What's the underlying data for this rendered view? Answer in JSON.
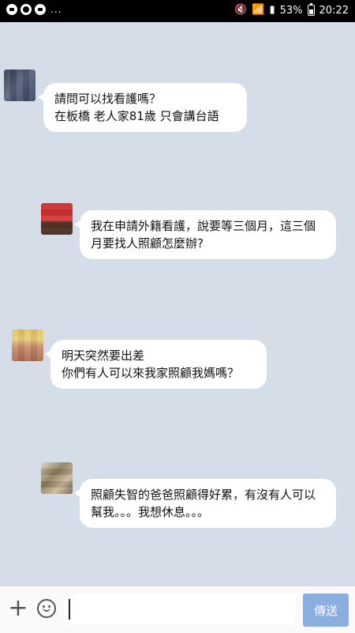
{
  "status_bar": {
    "left_icons": [
      "messenger-icon",
      "smiley-icon",
      "chat-icon"
    ],
    "more": "...",
    "right_icons": [
      "mute-icon",
      "wifi-icon",
      "signal-icon",
      "battery-icon"
    ],
    "battery": "53%",
    "time": "20:22"
  },
  "messages": [
    {
      "text": "請問可以找看護嗎？\n在板橋 老人家81歲 只會講台語"
    },
    {
      "text": "我在申請外籍看護，說要等三個月，這三個月要找人照顧怎麼辦?"
    },
    {
      "text": "明天突然要出差\n你們有人可以來我家照顧我媽嗎？"
    },
    {
      "text": "照顧失智的爸爸照顧得好累，有沒有人可以幫我。。。我想休息。。。"
    }
  ],
  "input_bar": {
    "add_icon": "+",
    "placeholder": "",
    "send_label": "傳送"
  },
  "colors": {
    "background": "#d5dde8",
    "bubble": "#ffffff",
    "send_button": "#8aaee0",
    "status_bar": "#000000"
  }
}
